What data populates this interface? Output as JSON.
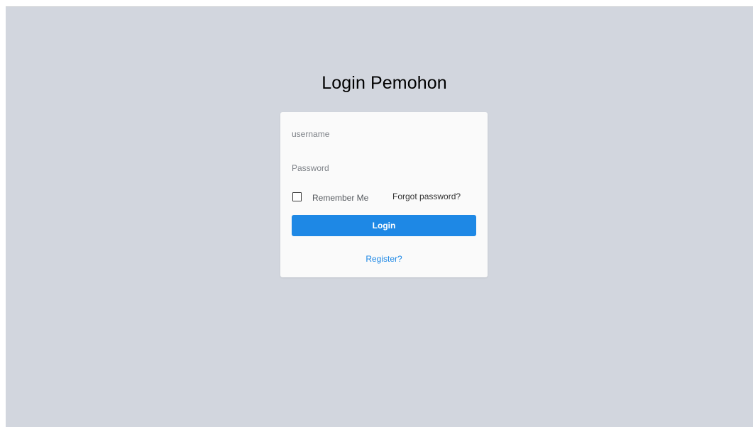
{
  "page": {
    "title": "Login Pemohon",
    "background_color": "#d2d6de"
  },
  "form": {
    "username_placeholder": "username",
    "username_value": "",
    "password_placeholder": "Password",
    "password_value": "",
    "remember_label": "Remember Me",
    "remember_checked": false,
    "forgot_label": "Forgot password?",
    "login_label": "Login",
    "register_label": "Register?"
  },
  "colors": {
    "accent": "#1e88e5",
    "card": "#fafafa"
  }
}
